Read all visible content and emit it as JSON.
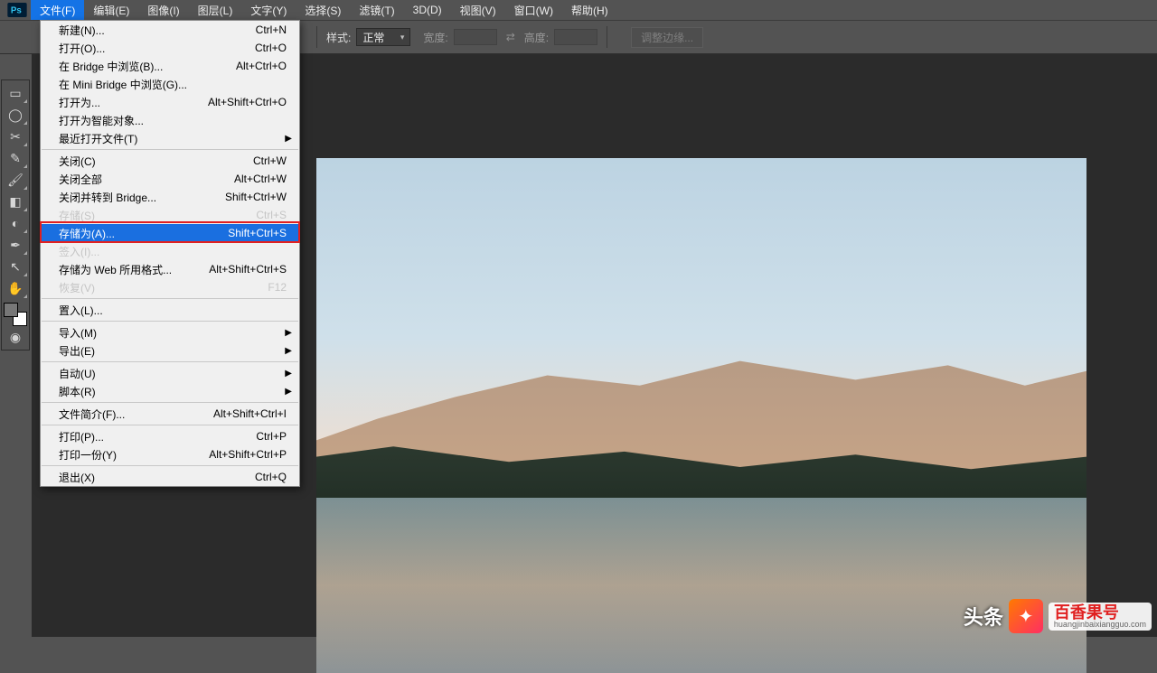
{
  "menubar": {
    "items": [
      "文件(F)",
      "编辑(E)",
      "图像(I)",
      "图层(L)",
      "文字(Y)",
      "选择(S)",
      "滤镜(T)",
      "3D(D)",
      "视图(V)",
      "窗口(W)",
      "帮助(H)"
    ],
    "open_index": 0
  },
  "optionsbar": {
    "style_label": "样式:",
    "style_value": "正常",
    "width_label": "宽度:",
    "height_label": "高度:",
    "refine_label": "调整边缘..."
  },
  "file_menu": [
    {
      "label": "新建(N)...",
      "shortcut": "Ctrl+N"
    },
    {
      "label": "打开(O)...",
      "shortcut": "Ctrl+O"
    },
    {
      "label": "在 Bridge 中浏览(B)...",
      "shortcut": "Alt+Ctrl+O"
    },
    {
      "label": "在 Mini Bridge 中浏览(G)...",
      "shortcut": ""
    },
    {
      "label": "打开为...",
      "shortcut": "Alt+Shift+Ctrl+O"
    },
    {
      "label": "打开为智能对象...",
      "shortcut": ""
    },
    {
      "label": "最近打开文件(T)",
      "shortcut": "",
      "submenu": true
    },
    {
      "sep": true
    },
    {
      "label": "关闭(C)",
      "shortcut": "Ctrl+W"
    },
    {
      "label": "关闭全部",
      "shortcut": "Alt+Ctrl+W"
    },
    {
      "label": "关闭并转到 Bridge...",
      "shortcut": "Shift+Ctrl+W"
    },
    {
      "label": "存储(S)",
      "shortcut": "Ctrl+S",
      "disabled": true
    },
    {
      "label": "存储为(A)...",
      "shortcut": "Shift+Ctrl+S",
      "selected": true
    },
    {
      "label": "签入(I)...",
      "shortcut": "",
      "disabled": true
    },
    {
      "label": "存储为 Web 所用格式...",
      "shortcut": "Alt+Shift+Ctrl+S"
    },
    {
      "label": "恢复(V)",
      "shortcut": "F12",
      "disabled": true
    },
    {
      "sep": true
    },
    {
      "label": "置入(L)...",
      "shortcut": ""
    },
    {
      "sep": true
    },
    {
      "label": "导入(M)",
      "shortcut": "",
      "submenu": true
    },
    {
      "label": "导出(E)",
      "shortcut": "",
      "submenu": true
    },
    {
      "sep": true
    },
    {
      "label": "自动(U)",
      "shortcut": "",
      "submenu": true
    },
    {
      "label": "脚本(R)",
      "shortcut": "",
      "submenu": true
    },
    {
      "sep": true
    },
    {
      "label": "文件简介(F)...",
      "shortcut": "Alt+Shift+Ctrl+I"
    },
    {
      "sep": true
    },
    {
      "label": "打印(P)...",
      "shortcut": "Ctrl+P"
    },
    {
      "label": "打印一份(Y)",
      "shortcut": "Alt+Shift+Ctrl+P"
    },
    {
      "sep": true
    },
    {
      "label": "退出(X)",
      "shortcut": "Ctrl+Q"
    }
  ],
  "tools": [
    "move",
    "marquee",
    "lasso",
    "crop",
    "eyedropper",
    "brush",
    "clone",
    "eraser",
    "gradient",
    "pen",
    "arrow",
    "hand"
  ],
  "watermark": {
    "left_text": "头条",
    "brand_cn": "百香果号",
    "brand_py": "huangjinbaixiangguo.com"
  }
}
